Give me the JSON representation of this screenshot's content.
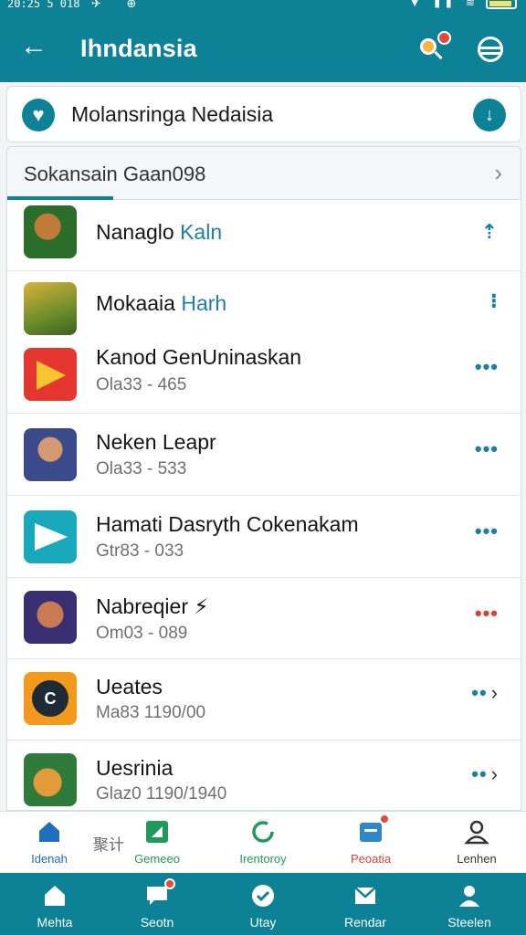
{
  "status_bar": {
    "time": "20:25 5 018",
    "icons_left": "✈ ⊕",
    "icons_right": "▼ ▮▮ ≋"
  },
  "app_bar": {
    "title": "Ihndansia"
  },
  "location": {
    "label": "Molansringa Nedaisia",
    "action_glyph": "↓"
  },
  "section": {
    "title": "Sokansain Gaan098"
  },
  "apps": [
    {
      "name": "Nanaglo",
      "name_accent": "Kaln",
      "subtitle": "",
      "action": "⇡"
    },
    {
      "name": "Mokaaia",
      "name_accent": "Harh",
      "subtitle": "",
      "action": "⁝"
    },
    {
      "name": "Kanod GenUninaskan",
      "name_accent": "",
      "subtitle": "Ola33 - 465",
      "action": "•••"
    },
    {
      "name": "Neken Leapr",
      "name_accent": "",
      "subtitle": "Ola33 - 533",
      "action": "•••"
    },
    {
      "name": "Hamati Dasryth Cokenakam",
      "name_accent": "",
      "subtitle": "Gtr83 - 033",
      "action": "•••"
    },
    {
      "name": "Nabreqier ⚡",
      "name_accent": "",
      "subtitle": "Om03 - 089",
      "action": "•••"
    },
    {
      "name": "Ueates",
      "name_accent": "",
      "subtitle": "Ma83 1190/00",
      "action": "••"
    },
    {
      "name": "Uesrinia",
      "name_accent": "",
      "subtitle": "Glaz0 1190/1940",
      "action": "••"
    }
  ],
  "top_nav": [
    {
      "label": "Idenah",
      "color": "#1d6fbf"
    },
    {
      "label": "Gemeeo",
      "color": "#1f9a5a"
    },
    {
      "label": "Irentoroy",
      "color": "#1f9a5a"
    },
    {
      "label": "Peoatia",
      "color": "#d9423b"
    },
    {
      "label": "Lenhen",
      "color": "#333333"
    }
  ],
  "top_nav_extra": "聚计",
  "bottom_nav": [
    {
      "label": "Mehta"
    },
    {
      "label": "Seotn"
    },
    {
      "label": "Utay"
    },
    {
      "label": "Rendar"
    },
    {
      "label": "Steelen"
    }
  ],
  "colors": {
    "brand": "#0d8196",
    "accent_blue": "#1d7fa6",
    "alert_red": "#e14b3c"
  }
}
